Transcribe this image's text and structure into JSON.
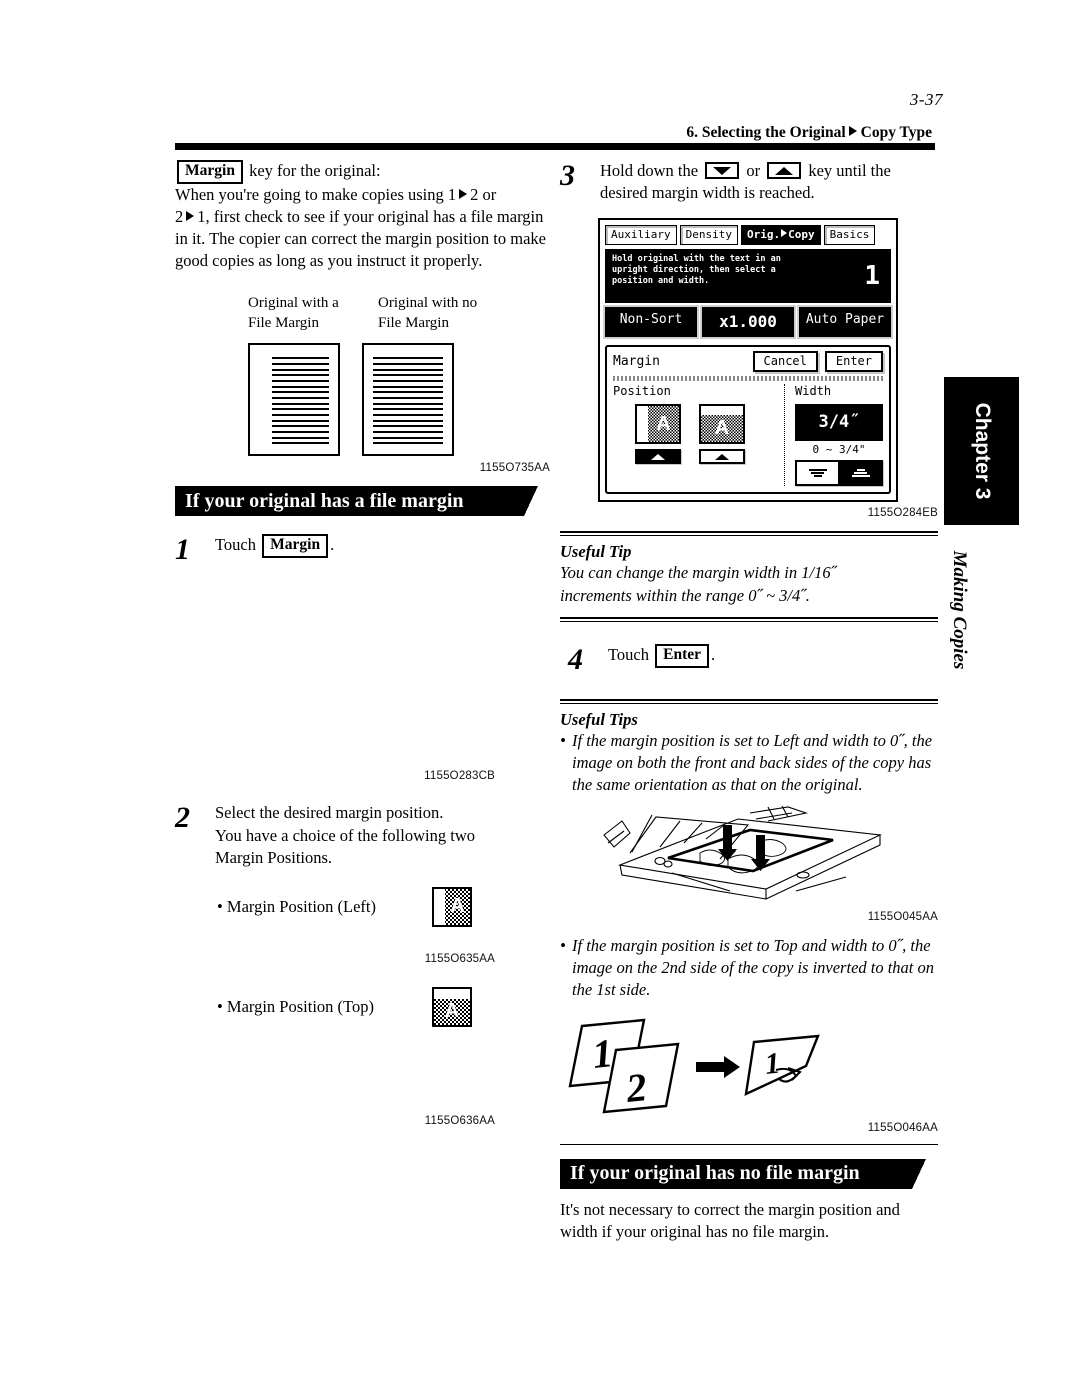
{
  "header": {
    "folio": "3-37",
    "running_head_left": "6. Selecting the Original",
    "running_head_right": "Copy Type"
  },
  "chapter_tab": {
    "label": "Chapter 3",
    "subtitle": "Making Copies"
  },
  "left_column": {
    "intro": {
      "key_label": "Margin",
      "after_key": "key for the original:",
      "paragraph_line1_a": "When you're going to make copies using 1",
      "paragraph_line1_b": "2 or",
      "paragraph_line2_a": "2",
      "paragraph_line2_b": "1, first check to see if your original has a file",
      "paragraph_rest": "margin in it. The copier can correct the margin position to make good copies as long as you instruct it properly."
    },
    "sample_figure": {
      "caption_left": "Original with a File Margin",
      "caption_right": "Original with no File Margin",
      "figure_id": "1155O735AA"
    },
    "section_heading": "If your original has a file margin",
    "step1": {
      "number": "1",
      "text_before": "Touch",
      "key_label": "Margin",
      "text_after": "."
    },
    "panel_figure_id": "1155O283CB",
    "step2": {
      "number": "2",
      "line1": "Select the desired margin position.",
      "line2": "You have a choice of the following two",
      "line3": "Margin Positions."
    },
    "margin_position_left": {
      "label": "• Margin Position (Left)",
      "icon_letter": "A",
      "figure_id": "1155O635AA"
    },
    "margin_position_top": {
      "label": "• Margin Position (Top)",
      "icon_letter": "A",
      "figure_id": "1155O636AA"
    }
  },
  "right_column": {
    "step3": {
      "number": "3",
      "text_a": "Hold down the",
      "key_down": "down-arrow-key",
      "text_or": "or",
      "key_up": "up-arrow-key",
      "text_b": "key until the",
      "line2": "desired margin width is reached."
    },
    "lcd": {
      "tabs": [
        {
          "label": "Auxiliary",
          "active": false
        },
        {
          "label": "Density",
          "active": false
        },
        {
          "label_left": "Orig.",
          "label_right": "Copy",
          "active": true
        },
        {
          "label": "Basics",
          "active": false
        }
      ],
      "message": "Hold original with the text in an upright direction, then select a position and width.",
      "copy_count": "1",
      "status_buttons": [
        "Non-Sort",
        "x1.000",
        "Auto Paper"
      ],
      "dialog": {
        "title": "Margin",
        "cancel": "Cancel",
        "enter": "Enter",
        "position_label": "Position",
        "width_label": "Width",
        "position_options": [
          {
            "name": "left",
            "letter": "A",
            "selected": true
          },
          {
            "name": "top",
            "letter": "A",
            "selected": false
          }
        ],
        "width_value": "3/4˝",
        "width_range": "0 ~ 3/4\"",
        "width_down": "decrease-width-button",
        "width_up": "increase-width-button"
      }
    },
    "lcd_figure_id": "1155O284EB",
    "useful_tip": {
      "heading": "Useful Tip",
      "line1": "You can change the margin width in 1/16˝",
      "line2": "increments within the range 0˝ ~ 3/4˝."
    },
    "step4": {
      "number": "4",
      "text_before": "Touch",
      "key_label": "Enter",
      "text_after": "."
    },
    "useful_tips": {
      "heading": "Useful Tips",
      "bullet1": "If the margin position is set to Left and width to 0˝, the image on both the front and back sides of the copy has the same orientation as that on the original.",
      "bullet1_figure_id": "1155O045AA",
      "bullet2": "If the margin position is set to Top and width to 0˝, the image on the 2nd side of the copy is inverted to that on the 1st side.",
      "bullet2_figure_id": "1155O046AA",
      "sheet1_label": "1",
      "sheet2_label": "2",
      "result_label": "1"
    },
    "section_heading": "If your original has no file margin",
    "closing_text": "It's not necessary to correct the margin position and width if your original has no file margin."
  }
}
